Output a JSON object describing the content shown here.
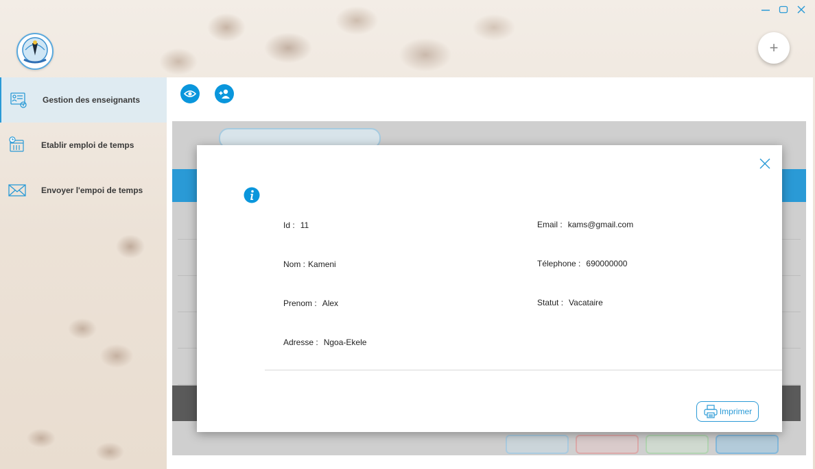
{
  "window": {
    "controls": [
      {
        "icon": "minimize-icon"
      },
      {
        "icon": "maximize-icon"
      },
      {
        "icon": "close-icon"
      }
    ]
  },
  "logo": {
    "text": "SUP'PTIC"
  },
  "fab": {
    "icon": "plus-icon",
    "symbol": "+"
  },
  "sidebar": {
    "items": [
      {
        "label": "Gestion des enseignants",
        "icon": "teacher-management-icon",
        "active": true
      },
      {
        "label": "Etablir emploi de temps",
        "icon": "calendar-clock-icon",
        "active": false
      },
      {
        "label": "Envoyer  l'empoi de temps",
        "icon": "envelope-icon",
        "active": false
      }
    ]
  },
  "toolbar": {
    "buttons": [
      {
        "icon": "eye-icon"
      },
      {
        "icon": "add-user-icon"
      }
    ]
  },
  "dialog": {
    "fields": {
      "id": {
        "label": "Id :",
        "value": "11"
      },
      "nom": {
        "label": "Nom :",
        "value": "Kameni"
      },
      "prenom": {
        "label": "Prenom :",
        "value": "Alex"
      },
      "adresse": {
        "label": "Adresse :",
        "value": "Ngoa-Ekele"
      },
      "email": {
        "label": "Email :",
        "value": "kams@gmail.com"
      },
      "telephone": {
        "label": "Télephone :",
        "value": "690000000"
      },
      "statut": {
        "label": "Statut :",
        "value": "Vacataire"
      }
    },
    "print_label": "Imprimer"
  },
  "colors": {
    "accent": "#2a9ad6",
    "button_blue": "#0a96dc"
  }
}
